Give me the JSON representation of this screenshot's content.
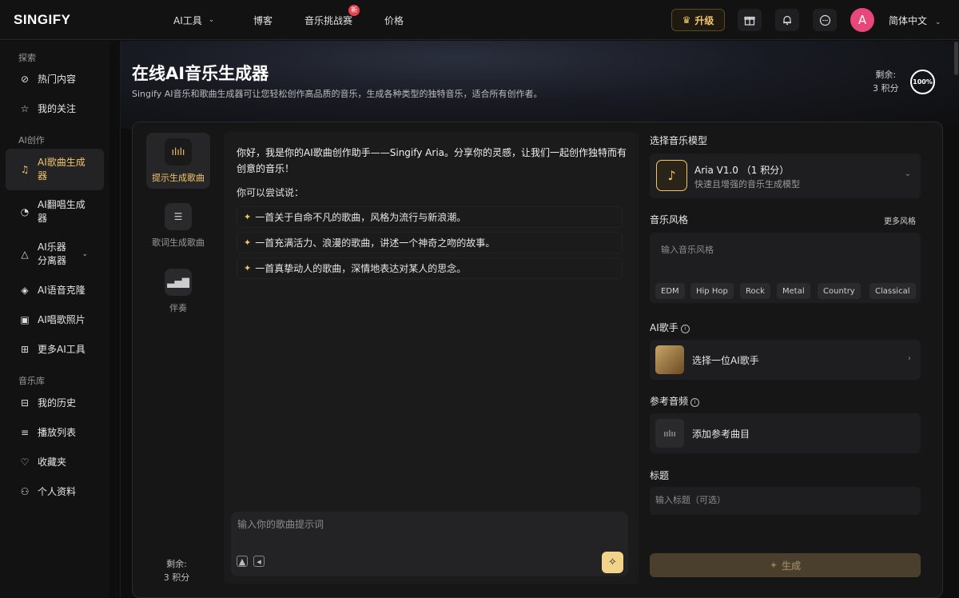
{
  "app": {
    "logo": "SINGIFY"
  },
  "nav": {
    "ai_tools": "AI工具",
    "blog": "博客",
    "challenge": "音乐挑战赛",
    "challenge_badge": "新",
    "pricing": "价格",
    "upgrade": "升级",
    "language": "简体中文",
    "avatar_letter": "A"
  },
  "sidebar": {
    "explore": "探索",
    "hot": "热门内容",
    "follow": "我的关注",
    "ai_create": "AI创作",
    "song_gen": "AI歌曲生成器",
    "cover_gen": "AI翻唱生成器",
    "separator": "AI乐器分离器",
    "voice_clone": "AI语音克隆",
    "sing_photo": "AI唱歌照片",
    "more_tools": "更多AI工具",
    "library": "音乐库",
    "history": "我的历史",
    "playlist": "播放列表",
    "favorites": "收藏夹",
    "profile": "个人资料"
  },
  "hero": {
    "title": "在线AI音乐生成器",
    "subtitle": "Singify AI音乐和歌曲生成器可让您轻松创作高品质的音乐，生成各种类型的独特音乐，适合所有创作者。",
    "remain_label": "剩余:",
    "remain_value": "3 积分",
    "percent": "100%"
  },
  "modes": {
    "prompt": "提示生成歌曲",
    "lyrics": "歌词生成歌曲",
    "accompaniment": "伴奏",
    "remain_label": "剩余:",
    "remain_value": "3 积分"
  },
  "chat": {
    "greeting": "你好，我是你的AI歌曲创作助手——Singify Aria。分享你的灵感，让我们一起创作独特而有创意的音乐！",
    "try_label": "你可以尝试说：",
    "suggestions": [
      "一首关于自命不凡的歌曲，风格为流行与新浪潮。",
      "一首充满活力、浪漫的歌曲，讲述一个神奇之吻的故事。",
      "一首真挚动人的歌曲，深情地表达对某人的思念。"
    ],
    "input_placeholder": "输入你的歌曲提示词"
  },
  "form": {
    "model_label": "选择音乐模型",
    "model_name": "Aria V1.0 （1 积分）",
    "model_desc": "快速且增强的音乐生成模型",
    "style_label": "音乐风格",
    "more_styles": "更多风格",
    "style_placeholder": "输入音乐风格",
    "tags": [
      "EDM",
      "Hip Hop",
      "Rock",
      "Metal",
      "Country",
      "Classical"
    ],
    "singer_label": "AI歌手",
    "singer_select": "选择一位AI歌手",
    "ref_label": "参考音频",
    "ref_add": "添加参考曲目",
    "title_label": "标题",
    "title_placeholder": "输入标题（可选）",
    "generate": "生成"
  }
}
